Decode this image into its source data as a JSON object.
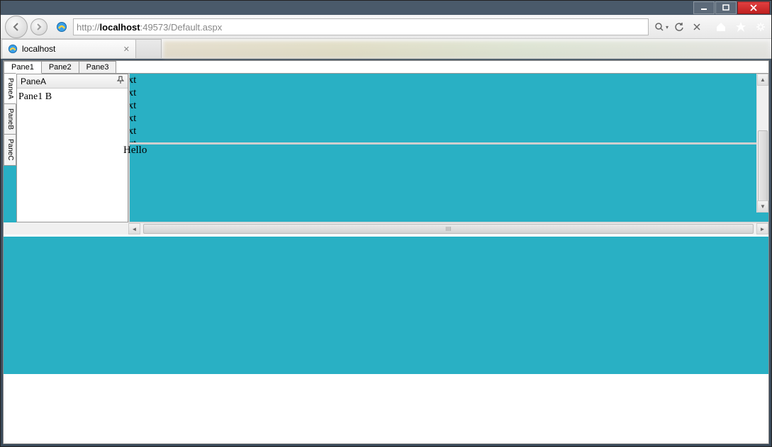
{
  "window": {
    "min_label": "_",
    "max_label": "□",
    "close_label": "✕"
  },
  "nav": {
    "url_proto": "http://",
    "url_host": "localhost",
    "url_port_path": ":49573/Default.aspx"
  },
  "browser_tab": {
    "title": "localhost"
  },
  "app_tabs": [
    "Pane1",
    "Pane2",
    "Pane3"
  ],
  "dock_tabs": [
    "PaneA",
    "PaneB",
    "PaneC"
  ],
  "pane_popout": {
    "title": "PaneA",
    "body_text": "Pane1 B"
  },
  "text_lines": [
    "ext",
    "ext",
    "ext",
    "ext",
    "ext",
    "ext"
  ],
  "hello_text": "Hello"
}
